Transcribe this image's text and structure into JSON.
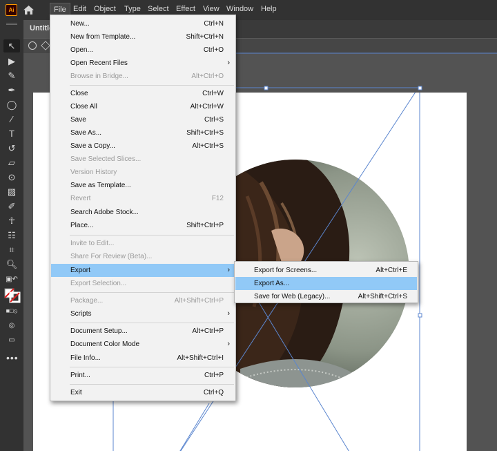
{
  "app": {
    "logo_text": "Ai"
  },
  "menubar": {
    "items": [
      "File",
      "Edit",
      "Object",
      "Type",
      "Select",
      "Effect",
      "View",
      "Window",
      "Help"
    ]
  },
  "document": {
    "tab_title": "Untitled"
  },
  "file_menu": {
    "new": {
      "label": "New...",
      "shortcut": "Ctrl+N"
    },
    "new_template": {
      "label": "New from Template...",
      "shortcut": "Shift+Ctrl+N"
    },
    "open": {
      "label": "Open...",
      "shortcut": "Ctrl+O"
    },
    "open_recent": {
      "label": "Open Recent Files"
    },
    "browse_bridge": {
      "label": "Browse in Bridge...",
      "shortcut": "Alt+Ctrl+O"
    },
    "close": {
      "label": "Close",
      "shortcut": "Ctrl+W"
    },
    "close_all": {
      "label": "Close All",
      "shortcut": "Alt+Ctrl+W"
    },
    "save": {
      "label": "Save",
      "shortcut": "Ctrl+S"
    },
    "save_as": {
      "label": "Save As...",
      "shortcut": "Shift+Ctrl+S"
    },
    "save_copy": {
      "label": "Save a Copy...",
      "shortcut": "Alt+Ctrl+S"
    },
    "save_slices": {
      "label": "Save Selected Slices..."
    },
    "version_history": {
      "label": "Version History"
    },
    "save_template": {
      "label": "Save as Template..."
    },
    "revert": {
      "label": "Revert",
      "shortcut": "F12"
    },
    "search_stock": {
      "label": "Search Adobe Stock..."
    },
    "place": {
      "label": "Place...",
      "shortcut": "Shift+Ctrl+P"
    },
    "invite_edit": {
      "label": "Invite to Edit..."
    },
    "share_review": {
      "label": "Share For Review (Beta)..."
    },
    "export": {
      "label": "Export"
    },
    "export_selection": {
      "label": "Export Selection..."
    },
    "package": {
      "label": "Package...",
      "shortcut": "Alt+Shift+Ctrl+P"
    },
    "scripts": {
      "label": "Scripts"
    },
    "doc_setup": {
      "label": "Document Setup...",
      "shortcut": "Alt+Ctrl+P"
    },
    "doc_color_mode": {
      "label": "Document Color Mode"
    },
    "file_info": {
      "label": "File Info...",
      "shortcut": "Alt+Shift+Ctrl+I"
    },
    "print": {
      "label": "Print...",
      "shortcut": "Ctrl+P"
    },
    "exit": {
      "label": "Exit",
      "shortcut": "Ctrl+Q"
    }
  },
  "export_submenu": {
    "screens": {
      "label": "Export for Screens...",
      "shortcut": "Alt+Ctrl+E"
    },
    "export_as": {
      "label": "Export As..."
    },
    "save_web": {
      "label": "Save for Web (Legacy)...",
      "shortcut": "Alt+Shift+Ctrl+S"
    }
  },
  "colors": {
    "menu_highlight": "#91c9f7",
    "selection_blue": "#4a78c8",
    "ui_dark": "#323232"
  }
}
